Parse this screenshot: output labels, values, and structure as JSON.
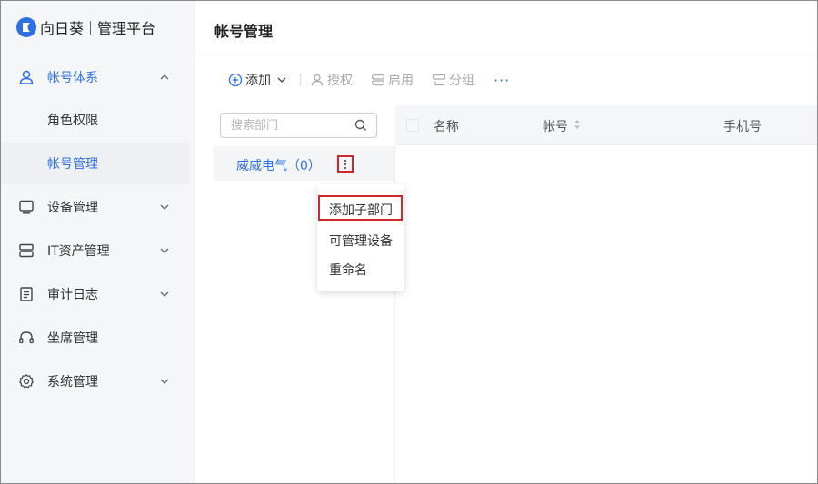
{
  "brand": {
    "name": "向日葵",
    "subtitle": "管理平台"
  },
  "sidebar": {
    "items": [
      {
        "label": "帐号体系",
        "icon": "user-icon",
        "expanded": true
      },
      {
        "label": "设备管理",
        "icon": "monitor-icon"
      },
      {
        "label": "IT资产管理",
        "icon": "server-icon"
      },
      {
        "label": "审计日志",
        "icon": "document-icon"
      },
      {
        "label": "坐席管理",
        "icon": "headset-icon"
      },
      {
        "label": "系统管理",
        "icon": "gear-icon"
      }
    ],
    "subitems": [
      {
        "label": "角色权限"
      },
      {
        "label": "帐号管理",
        "selected": true
      }
    ]
  },
  "main": {
    "title": "帐号管理",
    "toolbar": {
      "add": "添加",
      "authorize": "授权",
      "enable": "启用",
      "group": "分组",
      "more": "···"
    },
    "search": {
      "placeholder": "搜索部门",
      "value": ""
    },
    "tree": {
      "department": "威威电气（0）"
    },
    "table": {
      "columns": [
        "名称",
        "帐号",
        "手机号"
      ]
    },
    "context_menu": {
      "items": [
        "添加子部门",
        "可管理设备",
        "重命名"
      ]
    }
  },
  "colors": {
    "accent": "#2f6fe4",
    "highlight_border": "#d3242a",
    "sidebar_bg": "#f5f6f8"
  }
}
